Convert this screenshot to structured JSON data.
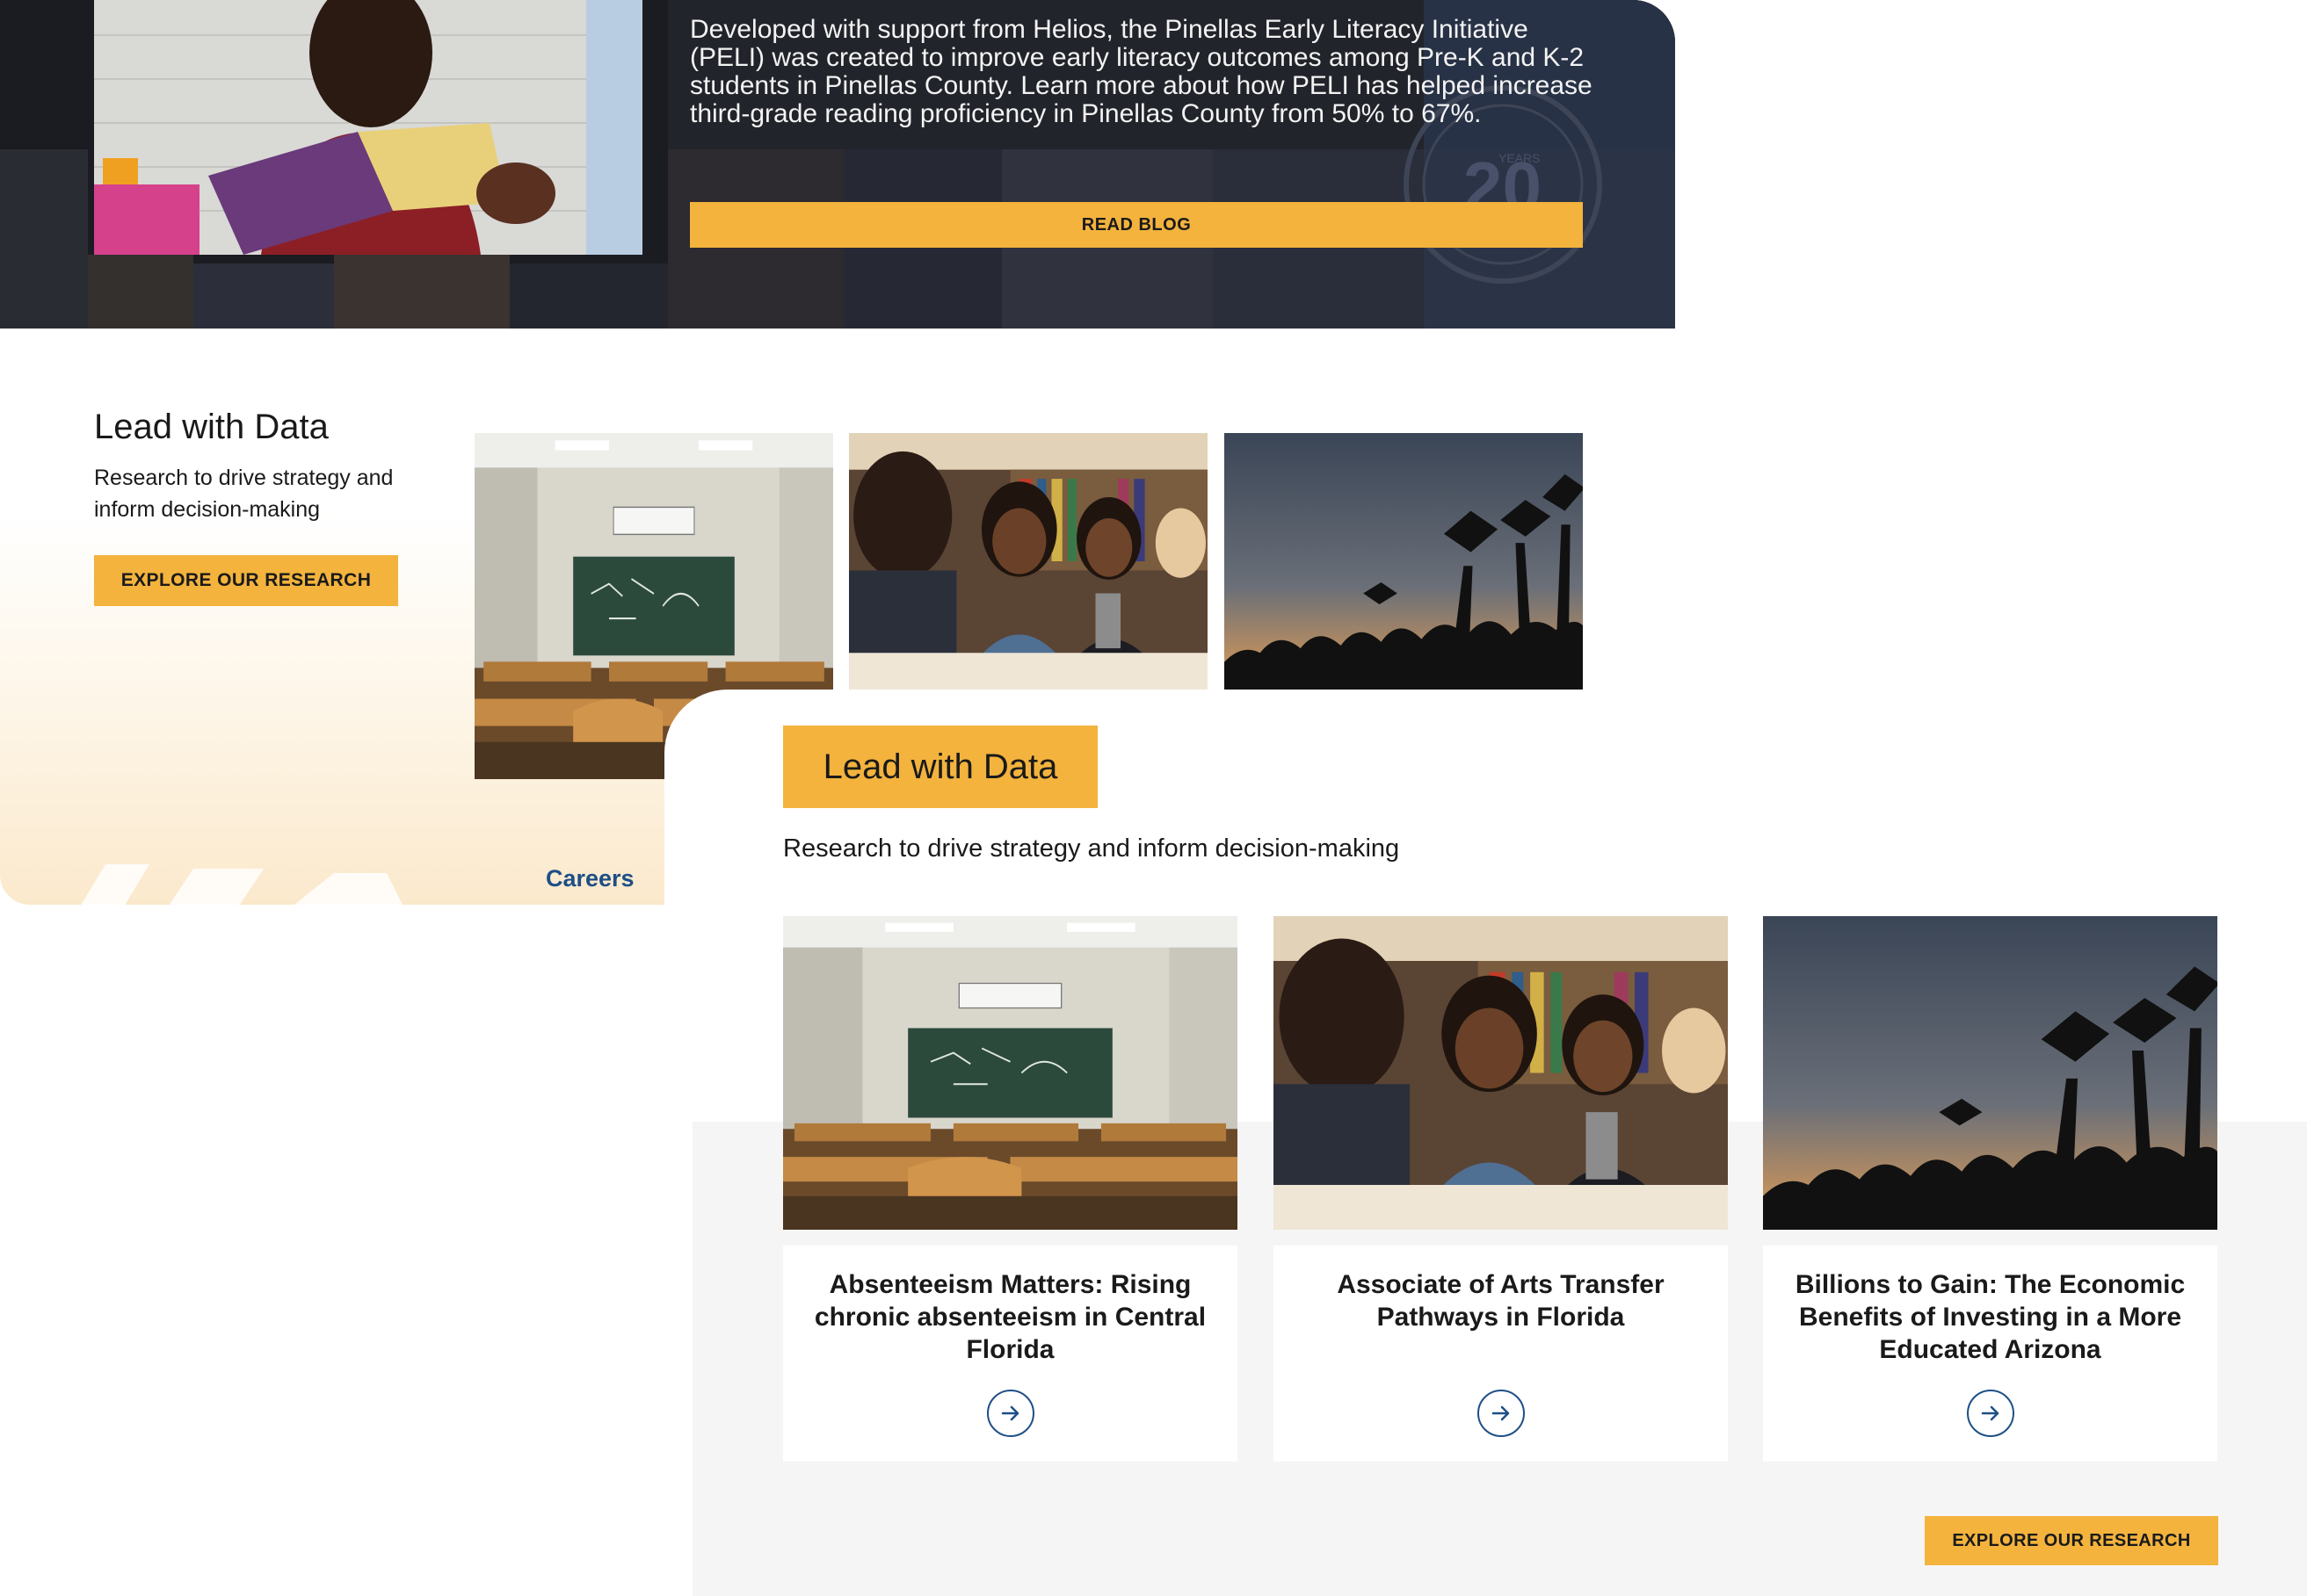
{
  "hero": {
    "text": "Developed with support from Helios, the Pinellas Early Literacy Initiative (PELI) was created to improve early literacy outcomes among Pre-K and K-2 students in Pinellas County. Learn more about how PELI has helped increase third-grade reading proficiency in Pinellas County from 50% to 67%.",
    "button_label": "READ BLOG",
    "badge_text": "20",
    "badge_sub": "YEARS"
  },
  "lead_small": {
    "title": "Lead with Data",
    "subtitle": "Research to drive strategy and inform decision-making",
    "button_label": "EXPLORE OUR RESEARCH",
    "careers_link": "Careers"
  },
  "lead_main": {
    "title": "Lead with Data",
    "subtitle": "Research to drive strategy and inform decision-making",
    "cards": [
      {
        "title": "Absenteeism Matters: Rising chronic absenteeism in Central Florida"
      },
      {
        "title": "Associate of Arts Transfer Pathways in Florida"
      },
      {
        "title": "Billions to Gain: The Economic Benefits of Investing in a More Educated Arizona"
      }
    ],
    "button_label": "EXPLORE OUR RESEARCH"
  },
  "colors": {
    "accent": "#f3b33d",
    "link": "#1d4f86",
    "hero_bg": "#1b1c22",
    "panel_grey": "#f5f5f5"
  }
}
